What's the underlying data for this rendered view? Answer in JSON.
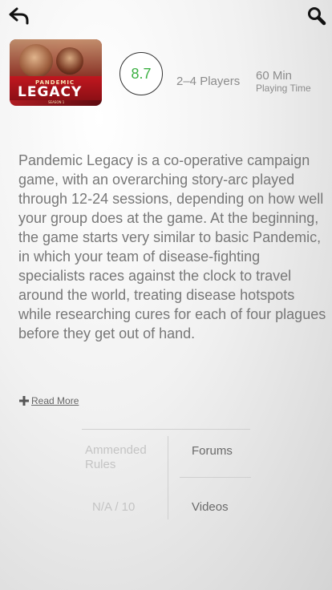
{
  "topbar": {
    "back_icon": "back-arrow-icon",
    "search_icon": "search-icon"
  },
  "game": {
    "cover": {
      "title_top": "PANDEMIC",
      "title_main": "LEGACY",
      "title_sub": "SEASON 1"
    },
    "rating": "8.7",
    "rating_color": "#3cb043",
    "players": "2–4 Players",
    "time_value": "60 Min",
    "time_label": "Playing Time"
  },
  "description": "Pandemic Legacy is a co-operative campaign game, with an overarching story-arc played through 12-24 sessions, depending on how well your group does at the game. At the beginning, the game starts very similar to basic Pandemic, in which your team of disease-fighting specialists races against the clock to travel around the world, treating disease hotspots while researching cures for each of four plagues before they get out of hand.",
  "read_more": {
    "icon": "plus-icon",
    "label": "Read More"
  },
  "links": {
    "rules": "Ammended Rules",
    "forums": "Forums",
    "score": "N/A / 10",
    "videos": "Videos"
  }
}
